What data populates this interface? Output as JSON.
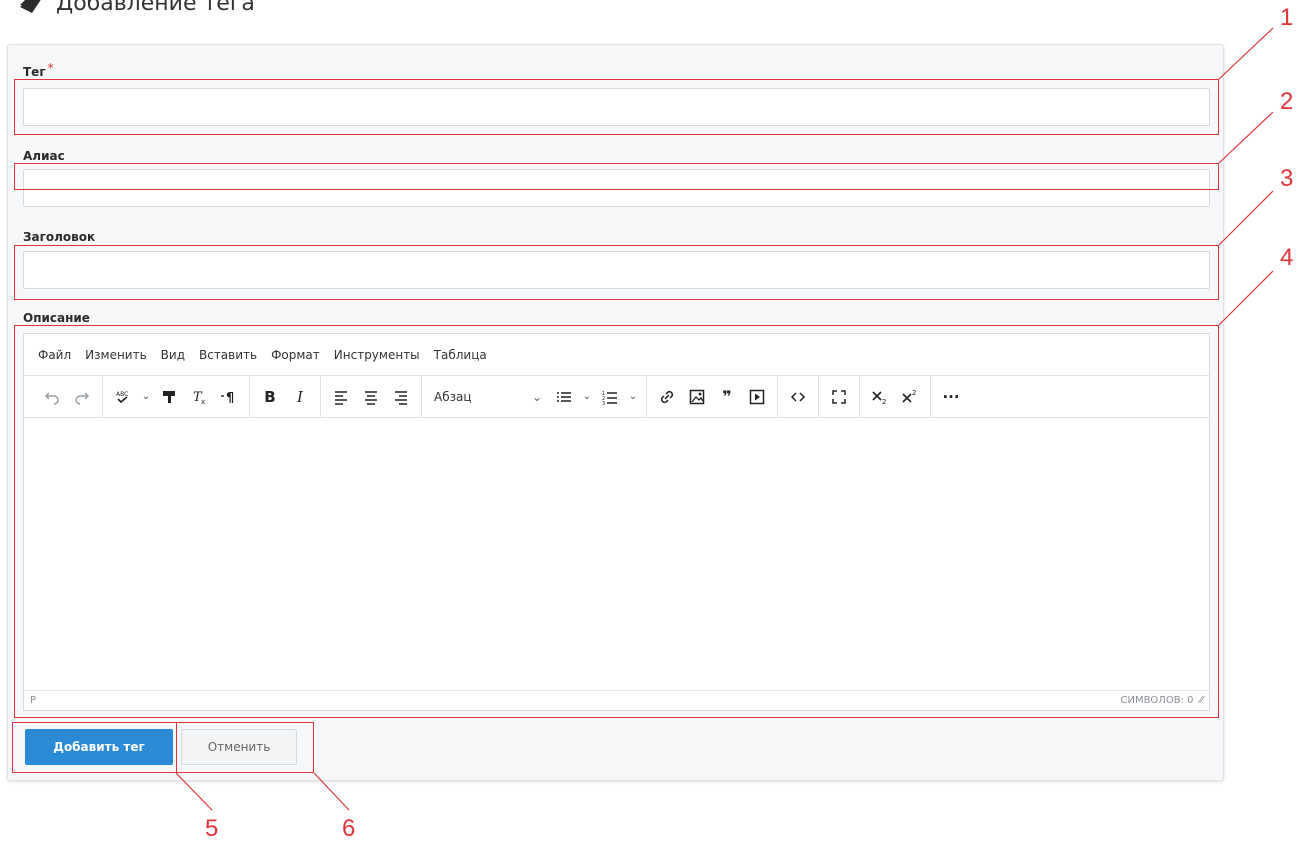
{
  "header": {
    "title": "Добавление тега"
  },
  "form": {
    "tag": {
      "label": "Тег",
      "required_mark": "*",
      "value": ""
    },
    "alias": {
      "label": "Алиас",
      "value": ""
    },
    "heading": {
      "label": "Заголовок",
      "value": ""
    },
    "description": {
      "label": "Описание"
    }
  },
  "editor": {
    "menu": [
      "Файл",
      "Изменить",
      "Вид",
      "Вставить",
      "Формат",
      "Инструменты",
      "Таблица"
    ],
    "block_format": "Абзац",
    "status_path": "P",
    "char_count": "СИМВОЛОВ: 0"
  },
  "buttons": {
    "submit": "Добавить тег",
    "cancel": "Отменить"
  },
  "callouts": [
    "1",
    "2",
    "3",
    "4",
    "5",
    "6"
  ],
  "colors": {
    "accent": "#2b8ad6",
    "annotation": "#e0343a"
  }
}
